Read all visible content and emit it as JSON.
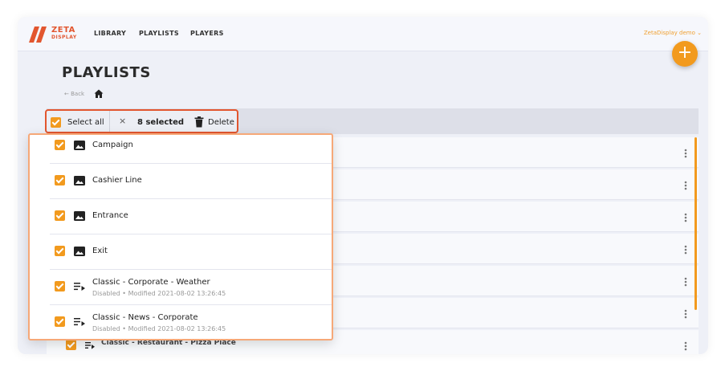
{
  "app": {
    "logo_primary": "ZETA",
    "logo_secondary": "DISPLAY",
    "brand_color": "#e2562f",
    "accent_color": "#f29a1e"
  },
  "nav": {
    "items": [
      {
        "label": "LIBRARY"
      },
      {
        "label": "PLAYLISTS"
      },
      {
        "label": "PLAYERS"
      }
    ],
    "user_label": "ZetaDisplay demo"
  },
  "page": {
    "title": "PLAYLISTS",
    "back_label": "Back"
  },
  "selection": {
    "select_all_label": "Select all",
    "clear_icon": "×",
    "count_label": "8 selected",
    "delete_label": "Delete"
  },
  "fab_icon": "+",
  "items": [
    {
      "icon": "image-icon",
      "name": "Campaign",
      "meta": "",
      "checked": true
    },
    {
      "icon": "image-icon",
      "name": "Cashier Line",
      "meta": "",
      "checked": true
    },
    {
      "icon": "image-icon",
      "name": "Entrance",
      "meta": "",
      "checked": true
    },
    {
      "icon": "image-icon",
      "name": "Exit",
      "meta": "",
      "checked": true
    },
    {
      "icon": "playlist-play-icon",
      "name": "Classic - Corporate - Weather",
      "status": "Disabled",
      "modified": "Modified 2021-08-02 13:26:45",
      "checked": true
    },
    {
      "icon": "playlist-play-icon",
      "name": "Classic - News - Corporate",
      "status": "Disabled",
      "modified": "Modified 2021-08-02 13:26:45",
      "checked": true
    }
  ],
  "background_last_item": "Classic - Restaurant - Pizza Place"
}
